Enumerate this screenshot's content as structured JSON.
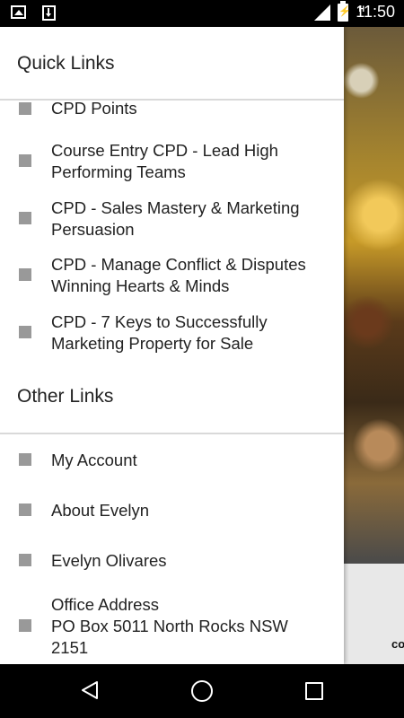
{
  "status_bar": {
    "time": "11:50",
    "network_type": "H",
    "icons": [
      "image-icon",
      "download-icon",
      "signal-icon",
      "battery-charging-icon"
    ]
  },
  "drawer": {
    "quick_links_title": "Quick Links",
    "quick_links": [
      {
        "line1": "CPD Points",
        "line2": ""
      },
      {
        "line1": "Course Entry CPD - Lead High",
        "line2": "Performing Teams"
      },
      {
        "line1": "CPD - Sales Mastery & Marketing",
        "line2": "Persuasion"
      },
      {
        "line1": "CPD - Manage Conflict & Disputes",
        "line2": "Winning Hearts & Minds"
      },
      {
        "line1": "CPD - 7 Keys to Successfully",
        "line2": "Marketing Property for Sale"
      }
    ],
    "other_links_title": "Other Links",
    "other_links": [
      {
        "line1": "My Account"
      },
      {
        "line1": "About Evelyn"
      },
      {
        "line1": "Evelyn Olivares"
      }
    ],
    "office": {
      "line1": "Office Address",
      "line2": "PO Box 5011 North Rocks NSW",
      "line3": "2151"
    }
  },
  "background": {
    "caption_fragment": "co"
  },
  "nav_bar": {
    "icons": [
      "back-icon",
      "home-icon",
      "recent-apps-icon"
    ]
  }
}
